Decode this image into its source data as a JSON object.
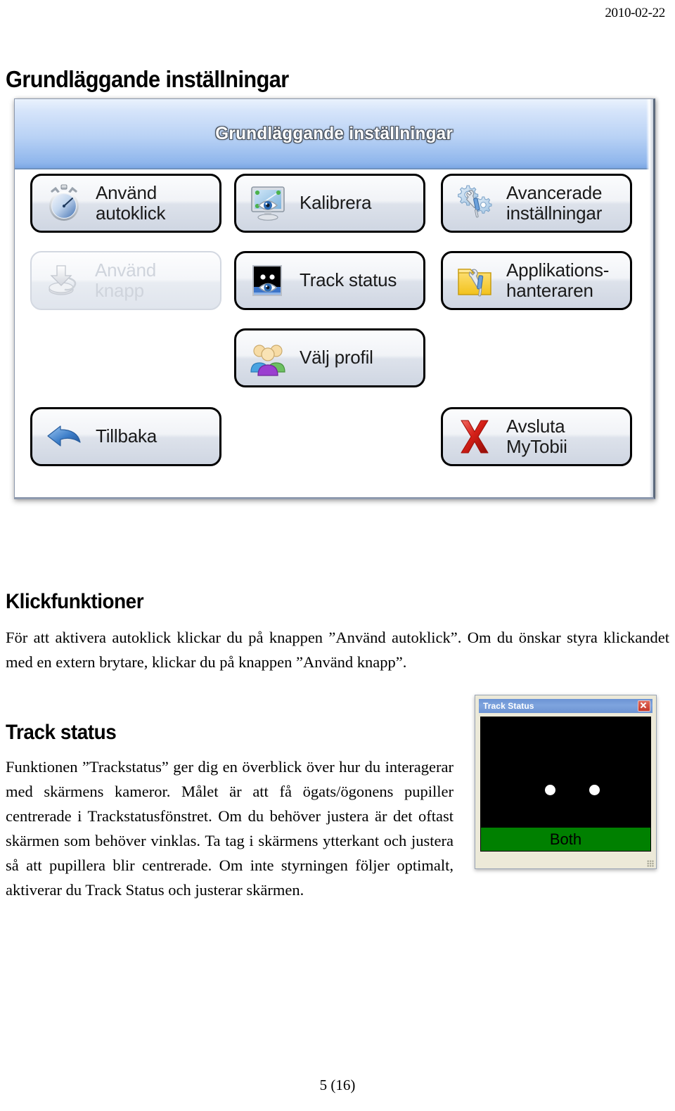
{
  "document": {
    "date": "2010-02-22",
    "title": "Grundläggande inställningar",
    "page_footer": "5 (16)"
  },
  "app_screenshot": {
    "titlebar": "Grundläggande inställningar",
    "buttons": [
      {
        "id": "autoklick",
        "label": "Använd\nautoklick",
        "icon": "stopwatch-icon",
        "enabled": true
      },
      {
        "id": "kalibrera",
        "label": "Kalibrera",
        "icon": "monitor-eye-icon",
        "enabled": true
      },
      {
        "id": "avancerade",
        "label": "Avancerade\ninställningar",
        "icon": "gears-tools-icon",
        "enabled": true
      },
      {
        "id": "knapp",
        "label": "Använd\nknapp",
        "icon": "switch-button-icon",
        "enabled": false
      },
      {
        "id": "trackstatus",
        "label": "Track status",
        "icon": "track-status-eye-icon",
        "enabled": true
      },
      {
        "id": "applikations",
        "label": "Applikations-\nhanteraren",
        "icon": "folder-tools-icon",
        "enabled": true
      },
      {
        "id": "profil",
        "label": "Välj profil",
        "icon": "users-icon",
        "enabled": true
      },
      {
        "id": "tillbaka",
        "label": "Tillbaka",
        "icon": "back-arrow-icon",
        "enabled": true
      },
      {
        "id": "avsluta",
        "label": "Avsluta\nMyTobii",
        "icon": "red-x-icon",
        "enabled": true
      }
    ]
  },
  "sections": {
    "klickfunktioner": {
      "heading": "Klickfunktioner",
      "body": "För att aktivera autoklick klickar du på knappen ”Använd autoklick”. Om du önskar styra klickandet med en extern brytare, klickar du på knappen ”Använd knapp”."
    },
    "track_status": {
      "heading": "Track status",
      "body": "Funktionen ”Trackstatus” ger dig en överblick över hur du interagerar med skärmens kameror. Målet är att få ögats/ögonens pupiller centrerade i Trackstatusfönstret. Om du behöver justera är det oftast skärmen som behöver vinklas. Ta tag i skärmens ytterkant och justera så att pupillera blir centrerade. Om inte styrningen följer optimalt, aktiverar du Track Status och justerar skärmen."
    }
  },
  "track_status_window": {
    "title": "Track Status",
    "close_icon": "close-icon",
    "status_label": "Both",
    "status_color": "#008000",
    "screen_color": "#000000",
    "pupil_color": "#ffffff",
    "pupils": 2
  },
  "colors": {
    "titlebar_blue_top": "#eaf2fd",
    "titlebar_blue_bottom": "#7ba7e4",
    "ts_titlebar": "#7ea4de",
    "ts_status_green": "#008000",
    "close_red": "#c4382a"
  }
}
